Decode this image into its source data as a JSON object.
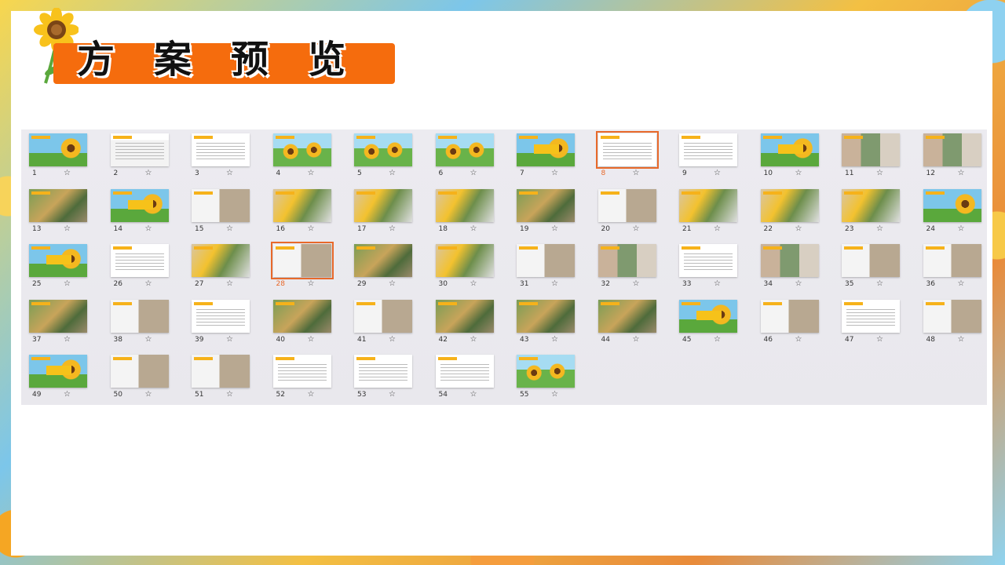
{
  "page": {
    "title": "方案预览"
  },
  "colors": {
    "accent_orange": "#f56c0d",
    "selected_outline": "#e8692a",
    "panel_bg": "#ecebf0"
  },
  "thumbnails": {
    "star_icon": "☆",
    "selected": [
      8,
      28
    ],
    "items": [
      {
        "num": "1"
      },
      {
        "num": "2"
      },
      {
        "num": "3"
      },
      {
        "num": "4"
      },
      {
        "num": "5"
      },
      {
        "num": "6"
      },
      {
        "num": "7"
      },
      {
        "num": "8"
      },
      {
        "num": "9"
      },
      {
        "num": "10"
      },
      {
        "num": "11"
      },
      {
        "num": "12"
      },
      {
        "num": "13"
      },
      {
        "num": "14"
      },
      {
        "num": "15"
      },
      {
        "num": "16"
      },
      {
        "num": "17"
      },
      {
        "num": "18"
      },
      {
        "num": "19"
      },
      {
        "num": "20"
      },
      {
        "num": "21"
      },
      {
        "num": "22"
      },
      {
        "num": "23"
      },
      {
        "num": "24"
      },
      {
        "num": "25"
      },
      {
        "num": "26"
      },
      {
        "num": "27"
      },
      {
        "num": "28"
      },
      {
        "num": "29"
      },
      {
        "num": "30"
      },
      {
        "num": "31"
      },
      {
        "num": "32"
      },
      {
        "num": "33"
      },
      {
        "num": "34"
      },
      {
        "num": "35"
      },
      {
        "num": "36"
      },
      {
        "num": "37"
      },
      {
        "num": "38"
      },
      {
        "num": "39"
      },
      {
        "num": "40"
      },
      {
        "num": "41"
      },
      {
        "num": "42"
      },
      {
        "num": "43"
      },
      {
        "num": "44"
      },
      {
        "num": "45"
      },
      {
        "num": "46"
      },
      {
        "num": "47"
      },
      {
        "num": "48"
      },
      {
        "num": "49"
      },
      {
        "num": "50"
      },
      {
        "num": "51"
      },
      {
        "num": "52"
      },
      {
        "num": "53"
      },
      {
        "num": "54"
      },
      {
        "num": "55"
      }
    ]
  }
}
